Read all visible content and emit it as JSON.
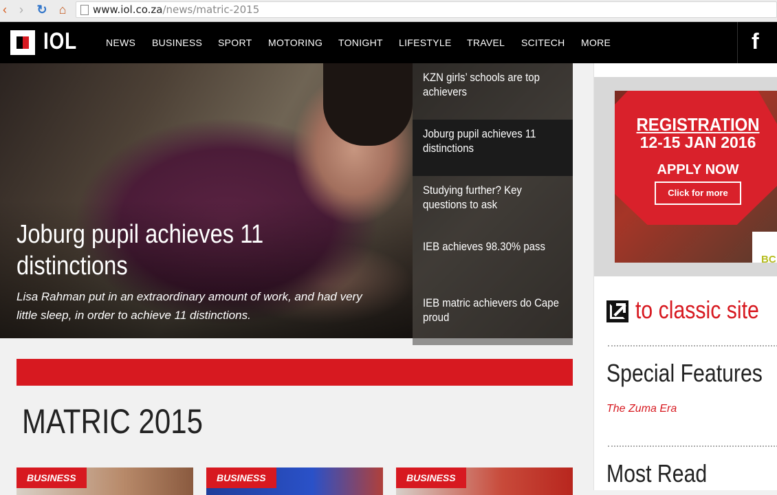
{
  "browser": {
    "url_host": "www.iol.co.za",
    "url_path": "/news/matric-2015"
  },
  "site": {
    "logo_text": "IOL",
    "nav": [
      "NEWS",
      "BUSINESS",
      "SPORT",
      "MOTORING",
      "TONIGHT",
      "LIFESTYLE",
      "TRAVEL",
      "SCITECH",
      "MORE"
    ],
    "social_icon": "f"
  },
  "hero": {
    "title": "Joburg pupil achieves 11 distinctions",
    "subtitle": "Lisa Rahman put in an extraordinary amount of work, and had very little sleep, in order to achieve 11 distinctions."
  },
  "side_stories": [
    "KZN girls’ schools are top achievers",
    "Joburg pupil achieves 11 distinctions",
    "Studying further? Key questions to ask",
    "IEB achieves 98.30% pass",
    "IEB matric achievers do Cape proud"
  ],
  "section": {
    "title": "MATRIC 2015",
    "cards": [
      {
        "tag": "BUSINESS"
      },
      {
        "tag": "BUSINESS"
      },
      {
        "tag": "BUSINESS"
      }
    ]
  },
  "sidebar": {
    "ad": {
      "line1": "REGISTRATION",
      "line2": "12-15 JAN 2016",
      "line3": "APPLY NOW",
      "button": "Click for more",
      "brand": "BC"
    },
    "classic_link": "to classic site",
    "special_features_heading": "Special Features",
    "special_features_link": "The Zuma Era",
    "most_read_heading": "Most Read"
  },
  "colors": {
    "brand_red": "#d71920",
    "header_bg": "#000000"
  }
}
